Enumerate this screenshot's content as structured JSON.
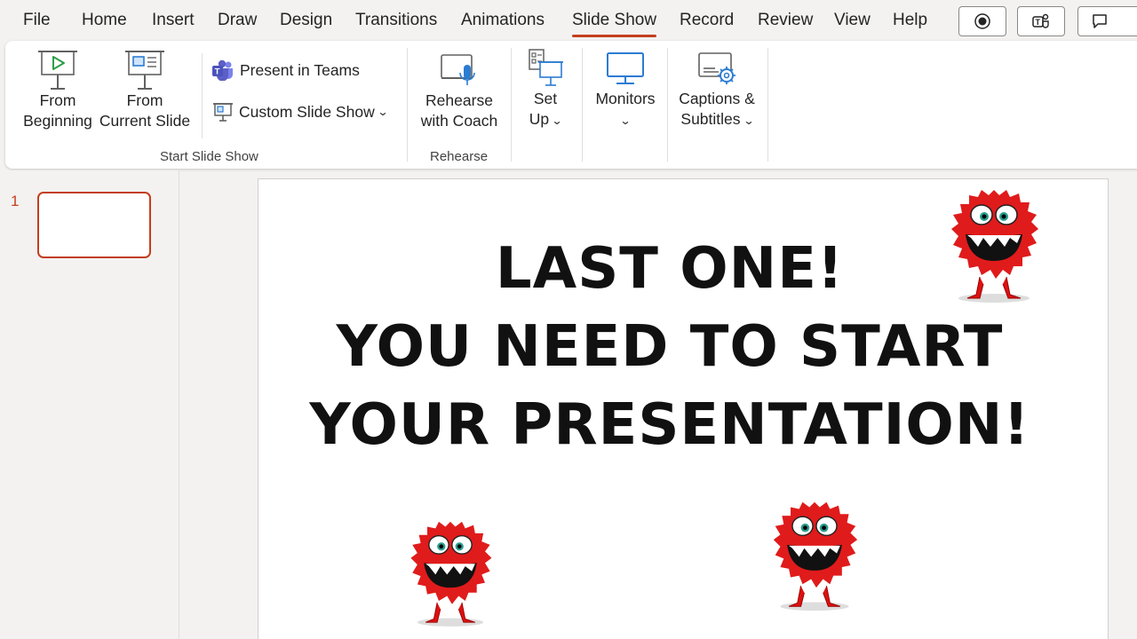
{
  "tabs": [
    "File",
    "Home",
    "Insert",
    "Draw",
    "Design",
    "Transitions",
    "Animations",
    "Slide Show",
    "Record",
    "Review",
    "View",
    "Help"
  ],
  "active_tab": "Slide Show",
  "ribbon": {
    "from_beginning": {
      "line1": "From",
      "line2": "Beginning"
    },
    "from_current": {
      "line1": "From",
      "line2": "Current Slide"
    },
    "present_in_teams": "Present in Teams",
    "custom_slide_show": "Custom Slide Show",
    "start_group_label": "Start Slide Show",
    "rehearse": {
      "line1": "Rehearse",
      "line2": "with Coach"
    },
    "rehearse_group_label": "Rehearse",
    "set_up": {
      "line1": "Set",
      "line2": "Up"
    },
    "monitors": "Monitors",
    "captions": {
      "line1": "Captions &",
      "line2": "Subtitles"
    }
  },
  "thumbnails": {
    "slide_number": "1"
  },
  "slide": {
    "line1": "LAST ONE!",
    "line2": "YOU NEED TO START",
    "line3": "YOUR PRESENTATION!"
  },
  "colors": {
    "accent": "#c43e1c",
    "teams": "#5b5fc7",
    "monster": "#e01b1b"
  }
}
